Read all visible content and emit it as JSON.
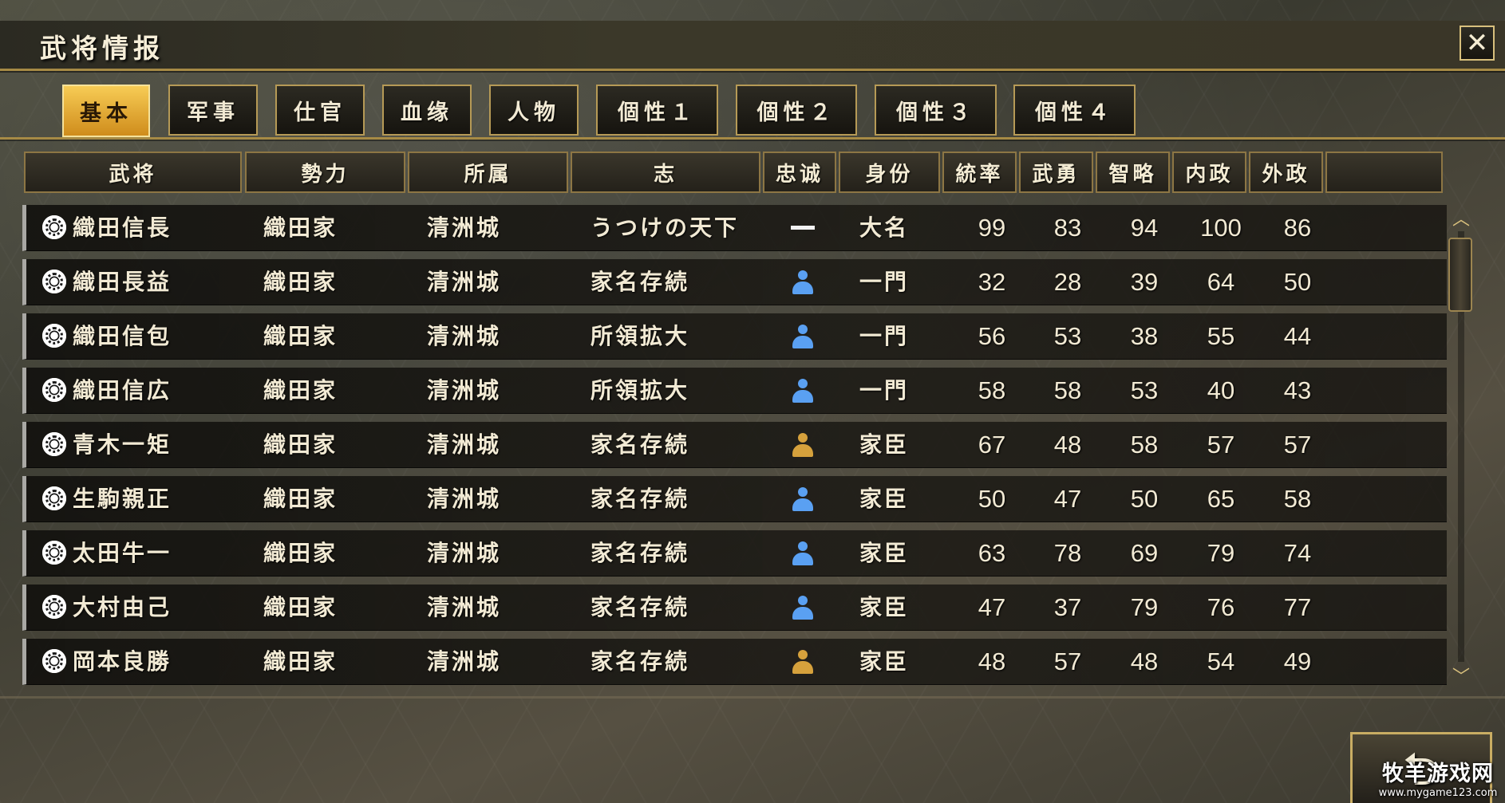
{
  "window": {
    "title": "武将情报",
    "close_label": "✕"
  },
  "tabs": [
    {
      "label": "基本",
      "active": true
    },
    {
      "label": "军事",
      "active": false
    },
    {
      "label": "仕官",
      "active": false
    },
    {
      "label": "血缘",
      "active": false
    },
    {
      "label": "人物",
      "active": false
    },
    {
      "label": "個性１",
      "active": false
    },
    {
      "label": "個性２",
      "active": false
    },
    {
      "label": "個性３",
      "active": false
    },
    {
      "label": "個性４",
      "active": false
    }
  ],
  "columns": {
    "name": "武将",
    "faction": "勢力",
    "castle": "所属",
    "ambition": "志",
    "loyalty": "忠诚",
    "rank": "身份",
    "lead": "統率",
    "valor": "武勇",
    "intel": "智略",
    "politics": "内政",
    "diplomacy": "外政",
    "extra": ""
  },
  "officers": [
    {
      "name": "織田信長",
      "faction": "織田家",
      "castle": "清洲城",
      "ambition": "うつけの天下",
      "loyalty": "none",
      "rank": "大名",
      "lead": "99",
      "valor": "83",
      "intel": "94",
      "politics": "100",
      "diplomacy": "86"
    },
    {
      "name": "織田長益",
      "faction": "織田家",
      "castle": "清洲城",
      "ambition": "家名存続",
      "loyalty": "blue",
      "rank": "一門",
      "lead": "32",
      "valor": "28",
      "intel": "39",
      "politics": "64",
      "diplomacy": "50"
    },
    {
      "name": "織田信包",
      "faction": "織田家",
      "castle": "清洲城",
      "ambition": "所領拡大",
      "loyalty": "blue",
      "rank": "一門",
      "lead": "56",
      "valor": "53",
      "intel": "38",
      "politics": "55",
      "diplomacy": "44"
    },
    {
      "name": "織田信広",
      "faction": "織田家",
      "castle": "清洲城",
      "ambition": "所領拡大",
      "loyalty": "blue",
      "rank": "一門",
      "lead": "58",
      "valor": "58",
      "intel": "53",
      "politics": "40",
      "diplomacy": "43"
    },
    {
      "name": "青木一矩",
      "faction": "織田家",
      "castle": "清洲城",
      "ambition": "家名存続",
      "loyalty": "gold",
      "rank": "家臣",
      "lead": "67",
      "valor": "48",
      "intel": "58",
      "politics": "57",
      "diplomacy": "57"
    },
    {
      "name": "生駒親正",
      "faction": "織田家",
      "castle": "清洲城",
      "ambition": "家名存続",
      "loyalty": "blue",
      "rank": "家臣",
      "lead": "50",
      "valor": "47",
      "intel": "50",
      "politics": "65",
      "diplomacy": "58"
    },
    {
      "name": "太田牛一",
      "faction": "織田家",
      "castle": "清洲城",
      "ambition": "家名存続",
      "loyalty": "blue",
      "rank": "家臣",
      "lead": "63",
      "valor": "78",
      "intel": "69",
      "politics": "79",
      "diplomacy": "74"
    },
    {
      "name": "大村由己",
      "faction": "織田家",
      "castle": "清洲城",
      "ambition": "家名存続",
      "loyalty": "blue",
      "rank": "家臣",
      "lead": "47",
      "valor": "37",
      "intel": "79",
      "politics": "76",
      "diplomacy": "77"
    },
    {
      "name": "岡本良勝",
      "faction": "織田家",
      "castle": "清洲城",
      "ambition": "家名存続",
      "loyalty": "gold",
      "rank": "家臣",
      "lead": "48",
      "valor": "57",
      "intel": "48",
      "politics": "54",
      "diplomacy": "49"
    }
  ],
  "icons": {
    "loyalty_blue_color": "#5aa0f2",
    "loyalty_gold_color": "#d6a13c",
    "scroll_up": "︿",
    "scroll_down": "﹀",
    "back": "⮌"
  },
  "watermark": {
    "main": "牧羊游戏网",
    "sub": "www.mygame123.com"
  },
  "theme": {
    "accent": "#b69a56",
    "active_tab": "#f0b83a"
  }
}
